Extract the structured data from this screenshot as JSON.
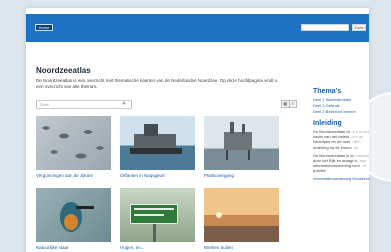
{
  "header": {
    "logo_label": "Home",
    "search_placeholder": "",
    "search_button": "Zoek"
  },
  "main": {
    "title": "Noordzeeatlas",
    "intro": "De Noordzeeatlas is een overzicht met thematische kaarten van de Nederlandse Noordzee. Op deze hoofdpagina vindt u een overzicht van alle thema's.",
    "filter_placeholder": "Zoek",
    "tiles": [
      {
        "caption": "Vergunningen aan de zijkant"
      },
      {
        "caption": "Olifanten in Naqsgeurt"
      },
      {
        "caption": "Plattsovergang"
      },
      {
        "caption": "Natuurlijke staat"
      },
      {
        "caption": "Hogen, en..."
      },
      {
        "caption": "Werken buiten"
      }
    ]
  },
  "sidebar": {
    "themes_heading": "Thema's",
    "theme_links": [
      "Deel 1 Waterdiensten",
      "Deel 2 Gebruik",
      "Deel 3 Beleid en beheer"
    ],
    "intro_heading": "Inleiding",
    "paragraphs": [
      "De Noordzeeatlas vindt u in het kader van het beleid voor de Noordzee en de ruimtelijke ordening op de Noordzee.",
      "De Noordzeeatlas is ontwikkeld door het Rijk en draagt bij aan informatievoorziening voor het publiek."
    ],
    "more_link": "Informatievoorziening Noordzee"
  }
}
